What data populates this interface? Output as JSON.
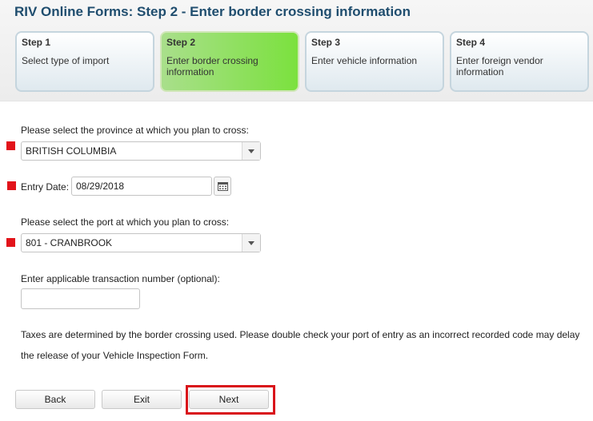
{
  "page_title": "RIV Online Forms: Step 2 - Enter border crossing information",
  "steps": [
    {
      "number": "Step 1",
      "description": "Select type of import",
      "active": false
    },
    {
      "number": "Step 2",
      "description": "Enter border crossing information",
      "active": true
    },
    {
      "number": "Step 3",
      "description": "Enter vehicle information",
      "active": false
    },
    {
      "number": "Step 4",
      "description": "Enter foreign vendor information",
      "active": false
    }
  ],
  "form": {
    "province_label": "Please select the province at which you plan to cross:",
    "province_value": "BRITISH COLUMBIA",
    "entry_date_label": "Entry Date:",
    "entry_date_value": "08/29/2018",
    "port_label": "Please select the port at which you plan to cross:",
    "port_value": "801 - CRANBROOK",
    "transaction_label": "Enter applicable transaction number (optional):",
    "transaction_value": "",
    "note": "Taxes are determined by the border crossing used. Please double check your port of entry as an incorrect recorded code may delay the release of your Vehicle Inspection Form."
  },
  "buttons": {
    "back": "Back",
    "exit": "Exit",
    "next": "Next"
  },
  "icons": {
    "required_marker": "required-marker-icon",
    "dropdown": "chevron-down-icon",
    "calendar": "calendar-icon"
  },
  "colors": {
    "title": "#1f4d6e",
    "active_step": "#7be13e",
    "required_marker": "#e2131a",
    "highlight": "#d9131a"
  }
}
